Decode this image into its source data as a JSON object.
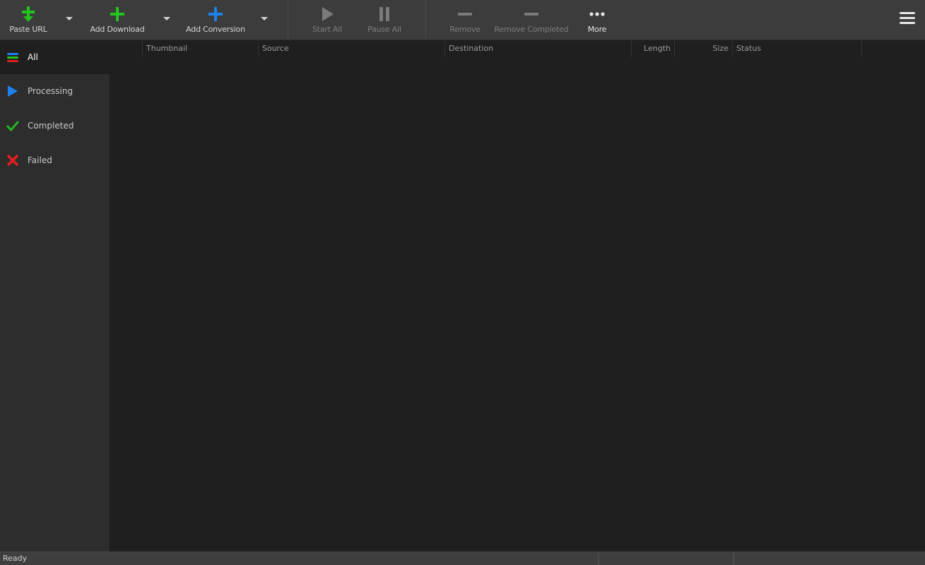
{
  "toolbar": {
    "paste_url": {
      "label": "Paste URL",
      "icon": "green-plus-down-arrow-icon",
      "color": "#22c41e"
    },
    "add_download": {
      "label": "Add Download",
      "icon": "green-plus-icon",
      "color": "#22c41e"
    },
    "add_conversion": {
      "label": "Add Conversion",
      "icon": "blue-plus-icon",
      "color": "#1e82ee"
    },
    "start_all": {
      "label": "Start All",
      "icon": "play-icon",
      "enabled": false
    },
    "pause_all": {
      "label": "Pause All",
      "icon": "pause-icon",
      "enabled": false
    },
    "remove": {
      "label": "Remove",
      "icon": "minus-icon",
      "enabled": false
    },
    "remove_completed": {
      "label": "Remove Completed",
      "icon": "minus-icon",
      "enabled": false
    },
    "more": {
      "label": "More",
      "icon": "ellipsis-icon"
    },
    "menu_icon": "hamburger-icon"
  },
  "sidebar": {
    "items": [
      {
        "label": "All",
        "icon": "list-icon",
        "active": true
      },
      {
        "label": "Processing",
        "icon": "play-icon",
        "color": "#1e82ee"
      },
      {
        "label": "Completed",
        "icon": "checkmark-icon",
        "color": "#22b81e"
      },
      {
        "label": "Failed",
        "icon": "x-icon",
        "color": "#e41e1e"
      }
    ]
  },
  "table": {
    "columns": [
      {
        "label": ""
      },
      {
        "label": "Thumbnail"
      },
      {
        "label": "Source"
      },
      {
        "label": "Destination"
      },
      {
        "label": "Length"
      },
      {
        "label": "Size"
      },
      {
        "label": "Status"
      }
    ],
    "rows": []
  },
  "statusbar": {
    "text": "Ready",
    "segments": [
      "",
      ""
    ]
  }
}
